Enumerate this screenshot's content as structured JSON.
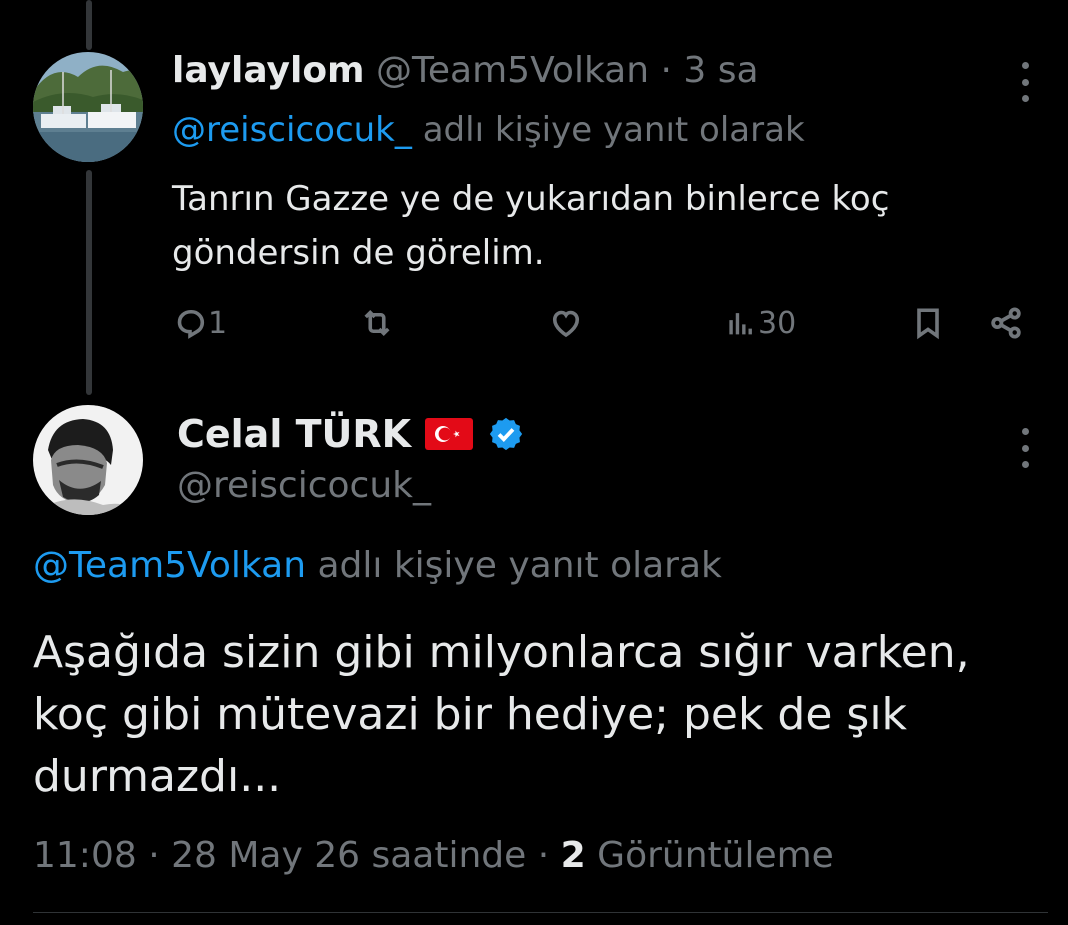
{
  "reply": {
    "display_name": "laylaylom",
    "handle": "@Team5Volkan",
    "time": "3 sa",
    "replying_to": "@reiscicocuk_",
    "replying_suffix": "adlı kişiye yanıt olarak",
    "text": "Tanrın Gazze ye de yukarıdan binlerce koç göndersin de görelim.",
    "reply_count": "1",
    "views": "30"
  },
  "main": {
    "display_name": "Celal TÜRK",
    "handle": "@reiscicocuk_",
    "replying_to": "@Team5Volkan",
    "replying_suffix": "adlı kişiye yanıt olarak",
    "text": "Aşağıda sizin gibi milyonlarca sığır varken, koç gibi mütevazi bir hediye; pek de şık durmazdı...",
    "time": "11:08",
    "date": "28 May 26 saatinde",
    "views_count": "2",
    "views_label": "Görüntüleme"
  },
  "colors": {
    "accent": "#1d9bf0",
    "muted": "#71767b",
    "text": "#e7e9ea",
    "background": "#000000"
  },
  "icons": [
    "reply-icon",
    "retweet-icon",
    "like-icon",
    "views-icon",
    "bookmark-icon",
    "share-icon",
    "more-icon",
    "verified-icon",
    "turkey-flag-icon"
  ]
}
